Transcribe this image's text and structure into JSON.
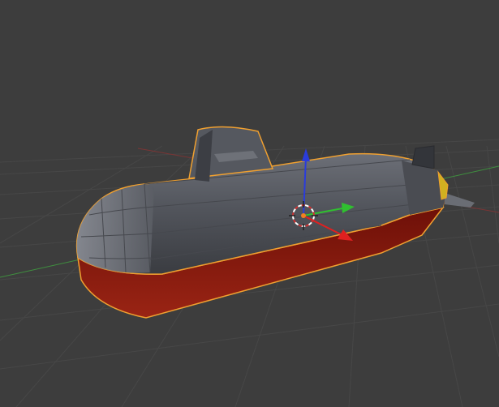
{
  "viewport": {
    "background": "#3d3d3d",
    "grid_color": "#4a4a4a",
    "x_axis_color": "#8a3a3a",
    "y_axis_color": "#3f8f3f"
  },
  "object": {
    "hull_color": "#5a5d64",
    "lower_hull_color": "#8a1a10",
    "selection_outline": "#f0a030"
  },
  "gizmo": {
    "x_color": "#e02020",
    "y_color": "#30c030",
    "z_color": "#2a3cdc",
    "cursor_icon": "3d-cursor-icon"
  }
}
